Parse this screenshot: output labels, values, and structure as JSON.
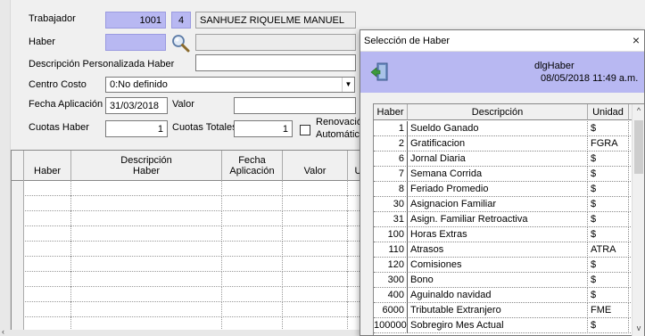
{
  "form": {
    "trabajador_label": "Trabajador",
    "trabajador_code": "1001",
    "trabajador_btn": "4",
    "trabajador_name": "SANHUEZ RIQUELME MANUEL",
    "haber_label": "Haber",
    "haber_value": "",
    "descripcion_label": "Descripción Personalizada Haber",
    "centro_costo_label": "Centro Costo",
    "centro_costo_value": "0:No definido",
    "fecha_aplicacion_label": "Fecha Aplicación",
    "fecha_aplicacion_value": "31/03/2018",
    "valor_label": "Valor",
    "cuotas_haber_label": "Cuotas Haber",
    "cuotas_haber_value": "1",
    "cuotas_totales_label": "Cuotas Totales",
    "cuotas_totales_value": "1",
    "renovacion_label1": "Renovación",
    "renovacion_label2": "Automática"
  },
  "grid": {
    "headers": {
      "haber": "Haber",
      "desc1": "Descripción",
      "desc2": "Haber",
      "fecha1": "Fecha",
      "fecha2": "Aplicación",
      "valor": "Valor",
      "extra": "U"
    }
  },
  "dialog": {
    "title": "Selección de Haber",
    "close": "×",
    "header_name": "dlgHaber",
    "header_date": "08/05/2018 11:49 a.m.",
    "columns": {
      "haber": "Haber",
      "descripcion": "Descripción",
      "unidad": "Unidad"
    },
    "rows": [
      {
        "haber": "1",
        "descripcion": "Sueldo Ganado",
        "unidad": "$"
      },
      {
        "haber": "2",
        "descripcion": "Gratificacion",
        "unidad": "FGRA"
      },
      {
        "haber": "6",
        "descripcion": "Jornal Diaria",
        "unidad": "$"
      },
      {
        "haber": "7",
        "descripcion": "Semana Corrida",
        "unidad": "$"
      },
      {
        "haber": "8",
        "descripcion": "Feriado Promedio",
        "unidad": "$"
      },
      {
        "haber": "30",
        "descripcion": "Asignacion Familiar",
        "unidad": "$"
      },
      {
        "haber": "31",
        "descripcion": "Asign. Familiar Retroactiva",
        "unidad": "$"
      },
      {
        "haber": "100",
        "descripcion": "Horas Extras",
        "unidad": "$"
      },
      {
        "haber": "110",
        "descripcion": "Atrasos",
        "unidad": "ATRA"
      },
      {
        "haber": "120",
        "descripcion": "Comisiones",
        "unidad": "$"
      },
      {
        "haber": "300",
        "descripcion": "Bono",
        "unidad": "$"
      },
      {
        "haber": "400",
        "descripcion": "Aguinaldo navidad",
        "unidad": "$"
      },
      {
        "haber": "6000",
        "descripcion": "Tributable Extranjero",
        "unidad": "FME"
      },
      {
        "haber": "100000",
        "descripcion": "Sobregiro Mes Actual",
        "unidad": "$"
      }
    ]
  },
  "icons": {
    "magnifier": "magnifier-icon",
    "exit": "exit-door-icon",
    "dropdown": "chevron-down-icon"
  }
}
